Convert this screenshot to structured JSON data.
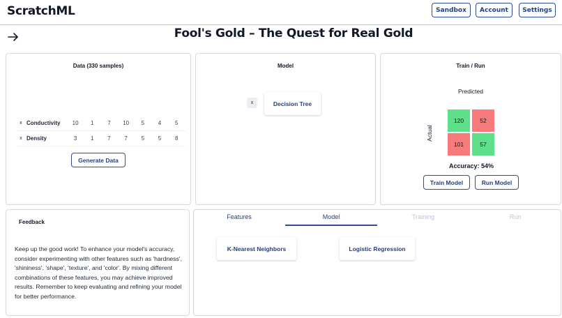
{
  "app": {
    "brand": "ScratchML"
  },
  "nav": {
    "sandbox": "Sandbox",
    "account": "Account",
    "settings": "Settings"
  },
  "page": {
    "title": "Fool's Gold – The Quest for Real Gold"
  },
  "data_panel": {
    "title": "Data (330 samples)",
    "features": [
      {
        "remove": "x",
        "name": "Conductivity",
        "values": [
          "10",
          "1",
          "7",
          "10",
          "5",
          "4",
          "5"
        ]
      },
      {
        "remove": "x",
        "name": "Density",
        "values": [
          "3",
          "1",
          "7",
          "7",
          "5",
          "5",
          "8"
        ]
      }
    ],
    "generate_label": "Generate Data"
  },
  "model_panel": {
    "title": "Model",
    "remove": "x",
    "selected_model": "Decision Tree"
  },
  "train_panel": {
    "title": "Train / Run",
    "predicted_label": "Predicted",
    "actual_label": "Actual",
    "matrix": [
      {
        "value": "120",
        "color": "#5ee08a"
      },
      {
        "value": "52",
        "color": "#f77b7b"
      },
      {
        "value": "101",
        "color": "#f77b7b"
      },
      {
        "value": "57",
        "color": "#5ee08a"
      }
    ],
    "accuracy": "Accuracy: 54%",
    "train_label": "Train Model",
    "run_label": "Run Model"
  },
  "feedback": {
    "title": "Feedback",
    "text": "Keep up the good work! To enhance your model's accuracy, consider experimenting with other features such as 'hardness', 'shininess', 'shape', 'texture', and 'color'. By mixing different combinations of these features, you may achieve improved results. Remember to keep evaluating and refining your model for better performance."
  },
  "tabs": [
    {
      "label": "Features",
      "state": "enabled"
    },
    {
      "label": "Model",
      "state": "active"
    },
    {
      "label": "Training",
      "state": "disabled"
    },
    {
      "label": "Run",
      "state": "disabled"
    }
  ],
  "model_options": [
    "K-Nearest Neighbors",
    "Logistic Regression"
  ],
  "colors": {
    "accent": "#2f4e93",
    "accent_text": "#24407e",
    "disabled": "#b9c6dc",
    "correct": "#5ee08a",
    "incorrect": "#f77b7b"
  }
}
